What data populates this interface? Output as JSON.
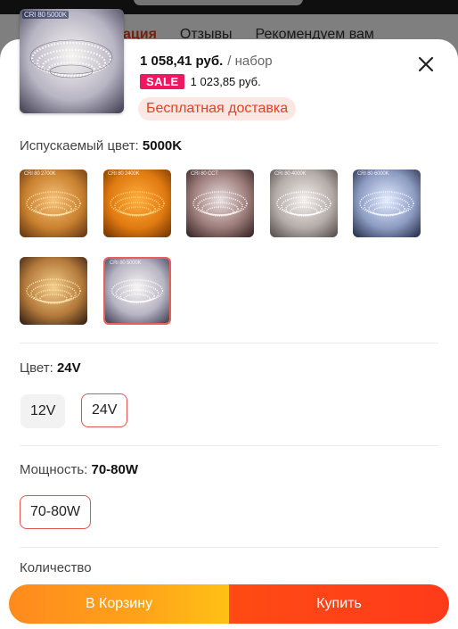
{
  "background_tabs": {
    "items": [
      "ация",
      "Отзывы",
      "Рекомендуем вам"
    ]
  },
  "product": {
    "thumb_label": "CRI 80 5000K",
    "price": "1 058,41 руб.",
    "unit": "/ набор",
    "sale_badge": "SALE",
    "sale_price": "1 023,85 руб.",
    "shipping": "Бесплатная доставка"
  },
  "colors": {
    "accent": "#e8401f",
    "sale_badge": "#f0165f",
    "cart_button": "#ffa319",
    "buy_button": "#ff4018"
  },
  "emitted_color": {
    "label": "Испускаемый цвет:",
    "selected": "5000K",
    "options": [
      {
        "label": "CRI 80 2700K",
        "tone": "warm"
      },
      {
        "label": "CRI 80 2400K",
        "tone": "amber"
      },
      {
        "label": "CRI 80 CCT",
        "tone": "cct"
      },
      {
        "label": "CRI 80 4000K",
        "tone": "neutral"
      },
      {
        "label": "CRI 80 6000K",
        "tone": "cool"
      },
      {
        "label": "",
        "tone": "warm2"
      },
      {
        "label": "CRI 80 5000K",
        "tone": "daylight"
      }
    ]
  },
  "voltage": {
    "label": "Цвет:",
    "selected": "24V",
    "options": [
      "12V",
      "24V"
    ]
  },
  "power": {
    "label": "Мощность:",
    "selected": "70-80W",
    "options": [
      "70-80W"
    ]
  },
  "quantity": {
    "label": "Количество"
  },
  "actions": {
    "cart": "В Корзину",
    "buy": "Купить"
  }
}
